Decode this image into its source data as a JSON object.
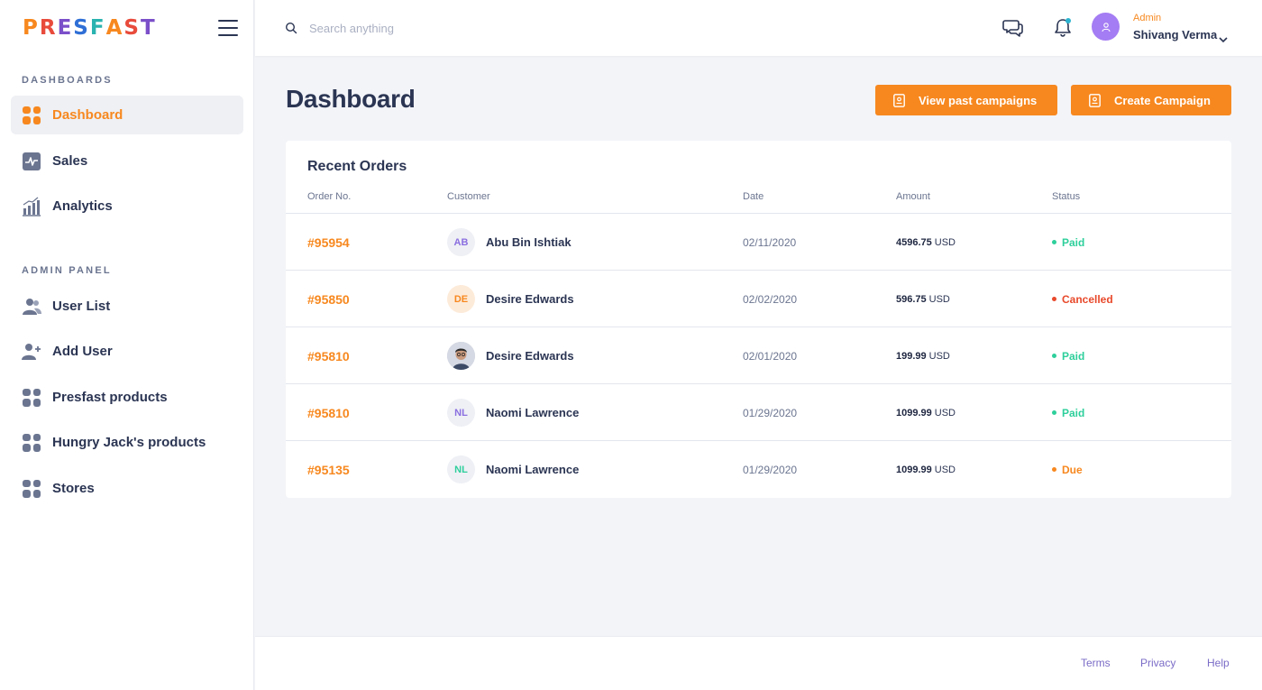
{
  "brand": {
    "letters": [
      "P",
      "R",
      "E",
      "S",
      "F",
      "A",
      "S",
      "T"
    ],
    "letter_colors": [
      "#f7881f",
      "#e84b3c",
      "#7b4fc9",
      "#2f6fd6",
      "#2ab3b0",
      "#f7881f",
      "#e84b3c",
      "#7b4fc9"
    ]
  },
  "sidebar": {
    "dashboards_label": "DASHBOARDS",
    "admin_label": "ADMIN PANEL",
    "dashboards_items": [
      {
        "label": "Dashboard",
        "icon": "grid-icon",
        "active": true
      },
      {
        "label": "Sales",
        "icon": "activity-icon",
        "active": false
      },
      {
        "label": "Analytics",
        "icon": "bar-chart-icon",
        "active": false
      }
    ],
    "admin_items": [
      {
        "label": "User List",
        "icon": "users-icon"
      },
      {
        "label": "Add User",
        "icon": "user-plus-icon"
      },
      {
        "label": "Presfast products",
        "icon": "grid-icon"
      },
      {
        "label": "Hungry Jack's products",
        "icon": "grid-icon"
      },
      {
        "label": "Stores",
        "icon": "grid-icon"
      }
    ]
  },
  "topbar": {
    "search_placeholder": "Search anything",
    "user_role": "Admin",
    "user_name": "Shivang Verma"
  },
  "main": {
    "title": "Dashboard",
    "buttons": {
      "view_past": "View past campaigns",
      "create": "Create Campaign"
    }
  },
  "orders": {
    "title": "Recent Orders",
    "columns": [
      "Order No.",
      "Customer",
      "Date",
      "Amount",
      "Status"
    ],
    "rows": [
      {
        "order_no": "#95954",
        "initials": "AB",
        "customer": "Abu Bin Ishtiak",
        "date": "02/11/2020",
        "amount": "4596.75",
        "unit": "USD",
        "status": "Paid"
      },
      {
        "order_no": "#95850",
        "initials": "DE",
        "customer": "Desire Edwards",
        "date": "02/02/2020",
        "amount": "596.75",
        "unit": "USD",
        "status": "Cancelled"
      },
      {
        "order_no": "#95810",
        "initials": "",
        "customer": "Desire Edwards",
        "date": "02/01/2020",
        "amount": "199.99",
        "unit": "USD",
        "status": "Paid"
      },
      {
        "order_no": "#95810",
        "initials": "NL",
        "customer": "Naomi Lawrence",
        "date": "01/29/2020",
        "amount": "1099.99",
        "unit": "USD",
        "status": "Paid"
      },
      {
        "order_no": "#95135",
        "initials": "NL",
        "customer": "Naomi Lawrence",
        "date": "01/29/2020",
        "amount": "1099.99",
        "unit": "USD",
        "status": "Due"
      }
    ]
  },
  "footer": {
    "links": [
      "Terms",
      "Privacy",
      "Help"
    ]
  },
  "colors": {
    "accent": "#f7881f",
    "paid": "#2ecf9b",
    "cancelled": "#e8492b",
    "due": "#f7881f",
    "link": "#7a6cc7"
  }
}
